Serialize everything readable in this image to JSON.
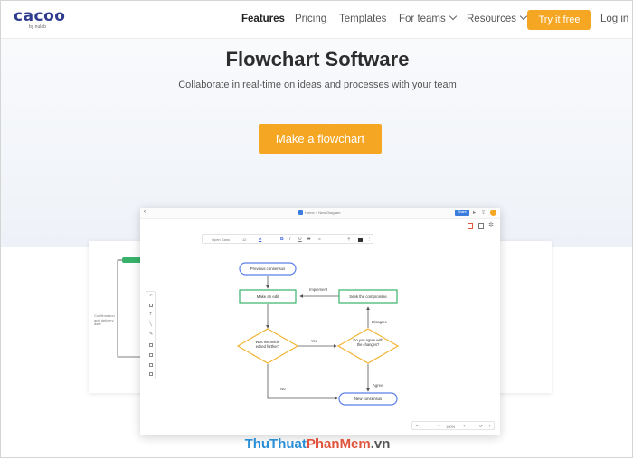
{
  "nav": {
    "logo_text": "cacoo",
    "logo_sub": "by nulab",
    "items": [
      {
        "label": "Features"
      },
      {
        "label": "Pricing"
      },
      {
        "label": "Templates"
      },
      {
        "label": "For teams"
      },
      {
        "label": "Resources"
      }
    ],
    "cta_label": "Try it free",
    "login_label": "Log in"
  },
  "hero": {
    "title": "Flowchart Software",
    "subtitle": "Collaborate in real-time on ideas and processes with your team",
    "button_label": "Make a flowchart"
  },
  "app": {
    "breadcrumb": "Home > New Diagram",
    "share_label": "Share",
    "font_name": "Open Sans",
    "font_size": "12",
    "zoom": "100%"
  },
  "back_card": {
    "label": "Confirmation and delivery date"
  },
  "flowchart": {
    "nodes": {
      "start": "Previous consensus",
      "edit": "Make an edit",
      "decision1": "Was the article edited further?",
      "decision2": "Do you agree with the changes?",
      "compromise": "Seek the compromise",
      "end": "New consensus"
    },
    "edges": {
      "yes": "Yes",
      "no": "No",
      "implement": "Implement",
      "disagree": "Disagree",
      "agree": "Agree"
    }
  },
  "watermark": {
    "part1": "ThuThuat",
    "part2": "PhanMem",
    "part3": ".vn"
  },
  "colors": {
    "accent": "#f5a623",
    "node_blue": "#5b7fe8",
    "node_green": "#38b26b",
    "node_yellow": "#f2b535"
  }
}
